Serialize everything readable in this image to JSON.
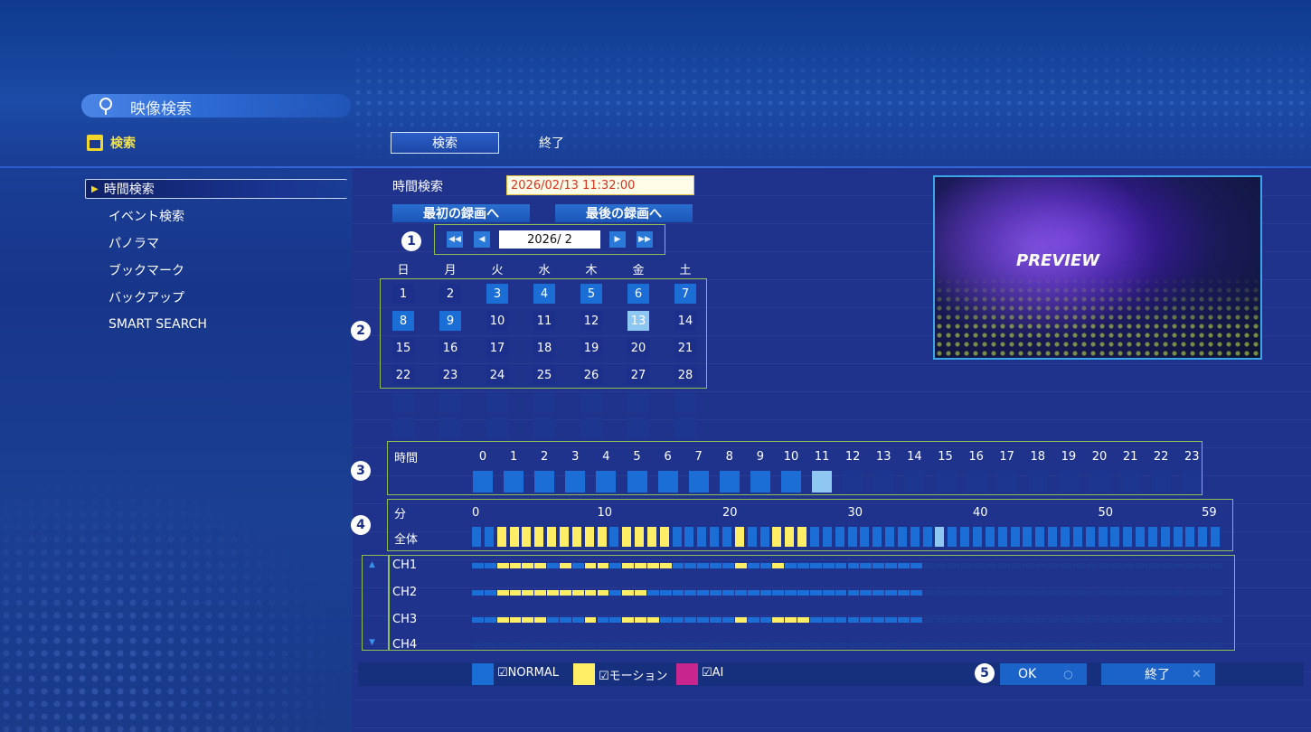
{
  "title": "映像検索",
  "section": "検索",
  "top_buttons": [
    "検索",
    "終了"
  ],
  "sidebar": {
    "items": [
      {
        "label": "時間検索",
        "selected": true
      },
      {
        "label": "イベント検索"
      },
      {
        "label": "パノラマ"
      },
      {
        "label": "ブックマーク"
      },
      {
        "label": "バックアップ"
      },
      {
        "label": "SMART SEARCH"
      }
    ]
  },
  "time_search": {
    "label": "時間検索",
    "value": "2026/02/13 11:32:00",
    "first_rec": "最初の録画へ",
    "last_rec": "最後の録画へ"
  },
  "calendar": {
    "month": "2026/ 2",
    "weekdays": [
      "日",
      "月",
      "火",
      "水",
      "木",
      "金",
      "土"
    ],
    "days": [
      {
        "d": "1",
        "s": "plain"
      },
      {
        "d": "2",
        "s": "plain"
      },
      {
        "d": "3",
        "s": "rec"
      },
      {
        "d": "4",
        "s": "rec"
      },
      {
        "d": "5",
        "s": "rec"
      },
      {
        "d": "6",
        "s": "rec"
      },
      {
        "d": "7",
        "s": "rec"
      },
      {
        "d": "8",
        "s": "rec"
      },
      {
        "d": "9",
        "s": "rec"
      },
      {
        "d": "10",
        "s": "plain"
      },
      {
        "d": "11",
        "s": "plain"
      },
      {
        "d": "12",
        "s": "plain"
      },
      {
        "d": "13",
        "s": "sel"
      },
      {
        "d": "14",
        "s": "plain"
      },
      {
        "d": "15",
        "s": "plain"
      },
      {
        "d": "16",
        "s": "plain"
      },
      {
        "d": "17",
        "s": "plain"
      },
      {
        "d": "18",
        "s": "plain"
      },
      {
        "d": "19",
        "s": "plain"
      },
      {
        "d": "20",
        "s": "plain"
      },
      {
        "d": "21",
        "s": "plain"
      },
      {
        "d": "22",
        "s": "plain"
      },
      {
        "d": "23",
        "s": "plain"
      },
      {
        "d": "24",
        "s": "plain"
      },
      {
        "d": "25",
        "s": "plain"
      },
      {
        "d": "26",
        "s": "plain"
      },
      {
        "d": "27",
        "s": "plain"
      },
      {
        "d": "28",
        "s": "plain"
      }
    ]
  },
  "preview_label": "PREVIEW",
  "markers": [
    "1",
    "2",
    "3",
    "4",
    "5"
  ],
  "hours": {
    "label": "時間",
    "ticks": [
      "0",
      "1",
      "2",
      "3",
      "4",
      "5",
      "6",
      "7",
      "8",
      "9",
      "10",
      "11",
      "12",
      "13",
      "14",
      "15",
      "16",
      "17",
      "18",
      "19",
      "20",
      "21",
      "22",
      "23"
    ],
    "recorded_until": 10,
    "selected": 11
  },
  "minutes": {
    "label": "分",
    "row_label": "全体",
    "ticks": [
      "0",
      "10",
      "20",
      "30",
      "40",
      "50",
      "59"
    ],
    "states": "NNYYYYYYYYYNYYYYNNNNNYNNYYYNNNNNNNNNNSNNNNNNNNNNNNNNNNNNNNNN"
  },
  "channels": [
    {
      "name": "CH1",
      "states": "NNYYYYNYNYYNYYYYNNNNNYNNYNNNNNNNNNNNEEEEEEEEEEEEEEEEEEEEEEEE"
    },
    {
      "name": "CH2",
      "states": "NNYYYYYYYYYNYYNNNNNNNNNNNNNNNNNNNNNNEEEEEEEEEEEEEEEEEEEEEEEE"
    },
    {
      "name": "CH3",
      "states": "NNYYYYNNNYNNYYYNNNNNNYNNYYYNNNNNNNNNEEEEEEEEEEEEEEEEEEEEEEEE"
    },
    {
      "name": "CH4",
      "states": "EEEEEEEEEEEEEEEEEEEEEEEEEEEEEEEEEEEEEEEEEEEEEEEEEEEEEEEEEEEE"
    }
  ],
  "legend": [
    {
      "label": "☑NORMAL",
      "color": "#1a6ed6"
    },
    {
      "label": "☑モーション",
      "color": "#ffee66"
    },
    {
      "label": "☑AI",
      "color": "#c8268e"
    }
  ],
  "footer": {
    "ok": "OK",
    "ok_glyph": "○",
    "exit": "終了",
    "exit_glyph": "✕"
  },
  "colors": {
    "normal": "#1a6ed6",
    "motion": "#ffee66",
    "ai": "#c8268e",
    "selected": "#8ec8f2",
    "empty": "#1d3690",
    "accent": "#f2d62a"
  }
}
